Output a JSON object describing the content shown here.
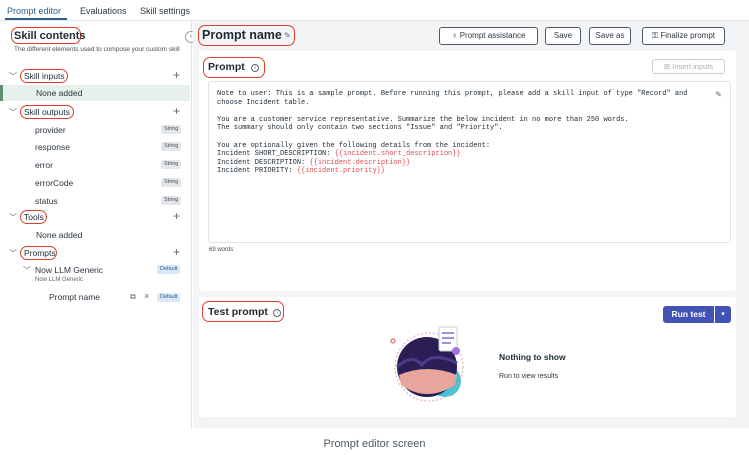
{
  "tabs": [
    {
      "label": "Prompt editor",
      "active": true
    },
    {
      "label": "Evaluations",
      "active": false
    },
    {
      "label": "Skill settings",
      "active": false
    }
  ],
  "sidebar": {
    "title": "Skill contents",
    "description": "The different elements used to compose your custom skill",
    "sections": {
      "inputs": {
        "label": "Skill inputs",
        "empty": "None added"
      },
      "outputs": {
        "label": "Skill outputs",
        "items": [
          {
            "label": "provider",
            "type": "String"
          },
          {
            "label": "response",
            "type": "String"
          },
          {
            "label": "error",
            "type": "String"
          },
          {
            "label": "errorCode",
            "type": "String"
          },
          {
            "label": "status",
            "type": "String"
          }
        ]
      },
      "tools": {
        "label": "Tools",
        "empty": "None added"
      },
      "prompts": {
        "label": "Prompts",
        "item": {
          "label": "Now LLM Generic",
          "sub": "Now LLM Generic",
          "badge": "Default"
        },
        "child": {
          "label": "Prompt name",
          "badge": "Default"
        }
      }
    }
  },
  "header": {
    "title": "Prompt name",
    "buttons": {
      "assistance": "Prompt assistance",
      "save": "Save",
      "save_as": "Save as",
      "finalize": "Finalize prompt"
    }
  },
  "prompt_card": {
    "title": "Prompt",
    "insert_inputs": "Insert inputs",
    "text": {
      "note1": "Note to user: This is a sample prompt. Before running this prompt, please add a skill input of type \"Record\" and",
      "note2": "choose Incident table.",
      "p1": "You are a customer service representative. Summarize the below incident in no more than 250 words.",
      "p2": "The summary should only contain two sections \"Issue\" and \"Priority\".",
      "p3": "You are optionally given the following details from the incident:",
      "f1_label": "Incident SHORT_DESCRIPTION: ",
      "f1_var": "{{incident.short_description}}",
      "f2_label": "Incident DESCRIPTION: ",
      "f2_var": "{{incident.description}}",
      "f3_label": "Incident PRIORITY: ",
      "f3_var": "{{incident.priority}}"
    },
    "word_count": "69 words"
  },
  "test_card": {
    "title": "Test prompt",
    "run_label": "Run test",
    "empty_title": "Nothing to show",
    "empty_sub": "Run to view results"
  },
  "caption": "Prompt editor screen",
  "colors": {
    "accent": "#2c5f8a",
    "primary_button": "#4353b5",
    "highlight_outline": "#d9402b",
    "variable": "#e24a50",
    "selected_row": "#e7f0ea"
  }
}
